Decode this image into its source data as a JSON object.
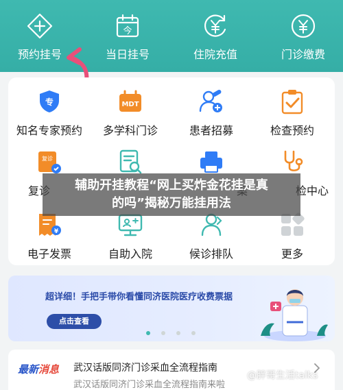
{
  "header": {
    "items": [
      {
        "label": "预约挂号",
        "icon": "plus-diamond-icon"
      },
      {
        "label": "当日挂号",
        "icon": "calendar-today-icon"
      },
      {
        "label": "住院充值",
        "icon": "yen-recharge-icon"
      },
      {
        "label": "门诊缴费",
        "icon": "yen-payment-icon"
      }
    ],
    "calendar_glyph": "今",
    "bg_color": "#3fb9b0"
  },
  "grid": {
    "items": [
      {
        "label": "知名专家预约",
        "icon": "expert-shield-icon"
      },
      {
        "label": "多学科门诊",
        "icon": "mdt-icon"
      },
      {
        "label": "患者招募",
        "icon": "patient-recruit-icon"
      },
      {
        "label": "检查预约",
        "icon": "checklist-icon"
      },
      {
        "label": "复诊",
        "icon": "revisit-icon"
      },
      {
        "label": "",
        "icon": "report-search-icon"
      },
      {
        "label": "案",
        "icon": "printer-icon"
      },
      {
        "label": "检中心",
        "icon": "stethoscope-icon"
      },
      {
        "label": "电子发票",
        "icon": "e-invoice-icon"
      },
      {
        "label": "自助入院",
        "icon": "self-admission-icon"
      },
      {
        "label": "候诊排队",
        "icon": "queue-icon"
      },
      {
        "label": "更多",
        "icon": "more-grid-icon"
      }
    ],
    "mdt_text": "MDT",
    "revisit_badge": "复诊"
  },
  "overlay": {
    "line1": "辅助开挂教程“网上买炸金花挂是真",
    "line2": "的吗”揭秘万能挂用法"
  },
  "promo": {
    "title": "超详细！手把手带你看懂同济医院医疗收费票据",
    "button": "点击查看",
    "dots": 4,
    "active_dot": 0
  },
  "news": {
    "tag_blue": "最新",
    "tag_red": "消息",
    "title": "武汉话版同济门诊采血全流程指南",
    "subtitle": "武汉话版同济门诊采血全流程指南来啦"
  },
  "watermark": "@胖哥生活talks",
  "colors": {
    "teal": "#3fb9b0",
    "orange": "#f28c28",
    "blue": "#2f7cf6",
    "pink": "#e8507a"
  }
}
